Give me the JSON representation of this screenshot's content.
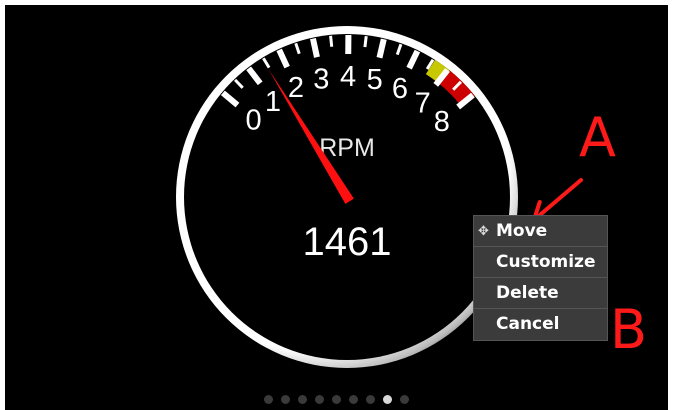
{
  "gauge": {
    "title": "RPM",
    "value": "1461",
    "scale_labels": [
      "0",
      "1",
      "2",
      "3",
      "4",
      "5",
      "6",
      "7",
      "8"
    ],
    "needle_value_thousands": 1.461,
    "zones": [
      {
        "name": "caution",
        "color": "#c8c800"
      },
      {
        "name": "redline",
        "color": "#cc0000"
      }
    ]
  },
  "context_menu": {
    "items": [
      {
        "label": "Move",
        "icon": "move-icon"
      },
      {
        "label": "Customize"
      },
      {
        "label": "Delete"
      },
      {
        "label": "Cancel"
      }
    ]
  },
  "pager": {
    "count": 9,
    "active_index": 7
  },
  "annotations": {
    "a_label": "A",
    "b_label": "B",
    "color": "#ff1a1a"
  }
}
